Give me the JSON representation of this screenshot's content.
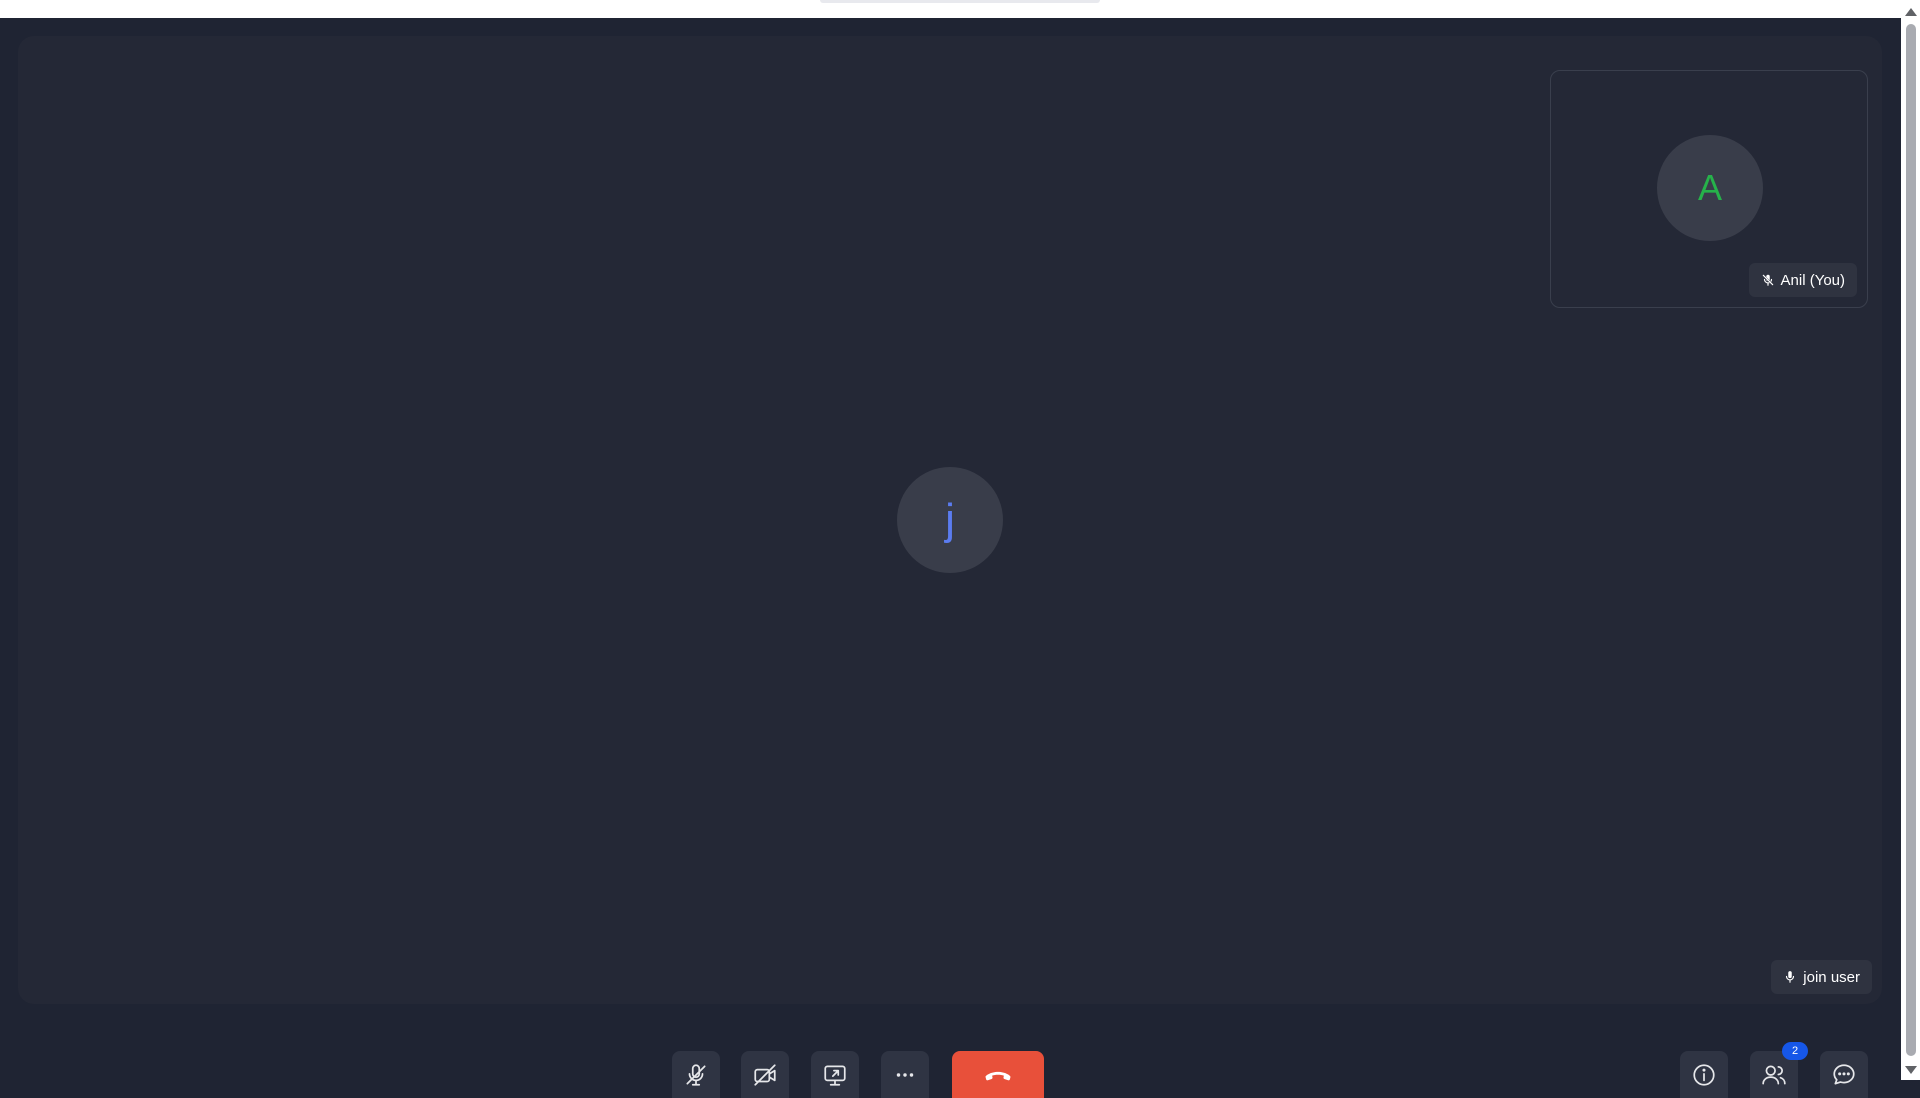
{
  "main_participant": {
    "initial": "j",
    "name": "join user",
    "initial_color": "#5b7cf0",
    "mic_icon": "mic-icon"
  },
  "self_participant": {
    "initial": "A",
    "name": "Anil (You)",
    "initial_color": "#26b24a",
    "mic_icon": "mic-muted-icon"
  },
  "controls": {
    "mic_icon": "mic-off-icon",
    "camera_icon": "camera-off-icon",
    "share_icon": "screen-share-icon",
    "more_icon": "more-horizontal-icon",
    "end_call_icon": "phone-hangup-icon",
    "end_call_color": "#e8503a",
    "info_icon": "info-icon",
    "participants_icon": "participants-icon",
    "participants_count": "2",
    "chat_icon": "chat-icon"
  }
}
